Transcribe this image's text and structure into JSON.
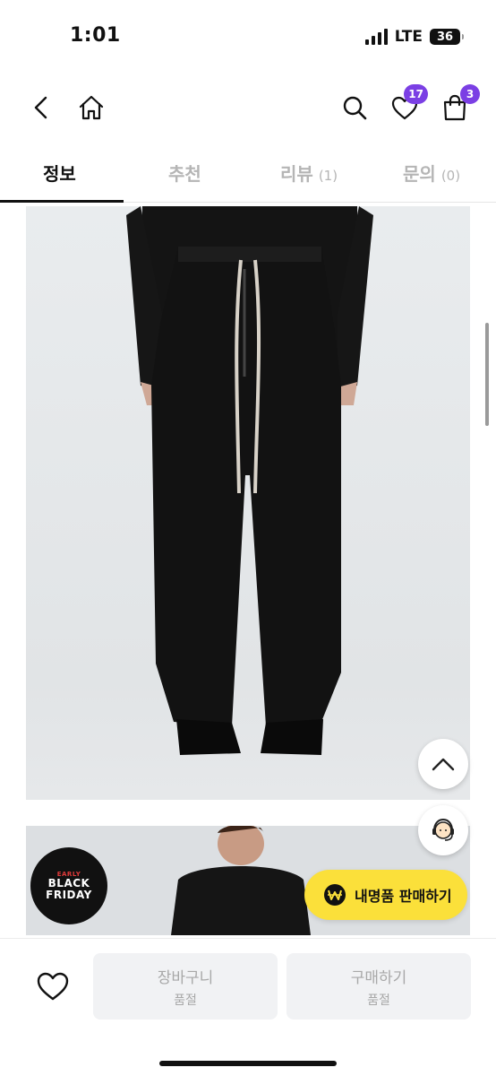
{
  "status_bar": {
    "time": "1:01",
    "network": "LTE",
    "battery": "36"
  },
  "header": {
    "wishlist_count": "17",
    "cart_count": "3",
    "badge_color": "#7b3fe4"
  },
  "tabs": [
    {
      "label": "정보",
      "count": ""
    },
    {
      "label": "추천",
      "count": ""
    },
    {
      "label": "리뷰",
      "count": "(1)"
    },
    {
      "label": "문의",
      "count": "(0)"
    }
  ],
  "promo": {
    "badge_early": "EARLY",
    "badge_line1": "BLACK",
    "badge_line2": "FRIDAY"
  },
  "floating": {
    "sell_label": "내명품 판매하기",
    "sell_color": "#fbe03a"
  },
  "bottom_bar": {
    "cart_label": "장바구니",
    "cart_status": "품절",
    "buy_label": "구매하기",
    "buy_status": "품절"
  },
  "icons": [
    "back-arrow-icon",
    "home-icon",
    "search-icon",
    "heart-icon",
    "shopping-bag-icon",
    "chevron-up-icon",
    "headset-icon",
    "won-icon",
    "heart-outline-icon"
  ]
}
